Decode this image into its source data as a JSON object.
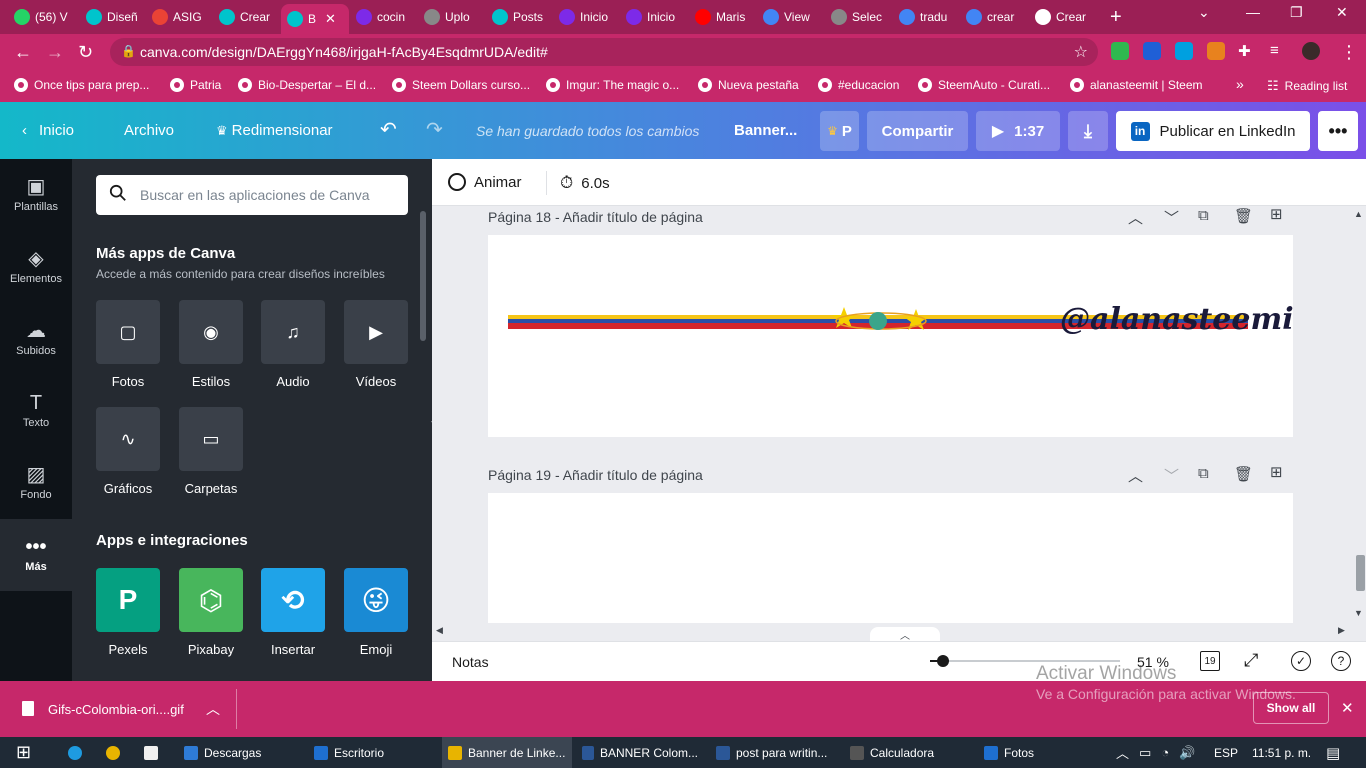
{
  "browser": {
    "tabs": [
      {
        "label": "(56) V",
        "icon": "whatsapp-icon",
        "color": "#25d366"
      },
      {
        "label": "Diseñ",
        "icon": "canva-icon",
        "color": "#00c4cc"
      },
      {
        "label": "ASIG",
        "icon": "gmail-icon",
        "color": "#ea4335"
      },
      {
        "label": "Crear",
        "icon": "canva-icon",
        "color": "#00c4cc"
      },
      {
        "label": "B",
        "icon": "canva-icon",
        "color": "#00c4cc"
      },
      {
        "label": "cocin",
        "icon": "canva-icon",
        "color": "#7d2ae8"
      },
      {
        "label": "Uplo",
        "icon": "upload-icon",
        "color": "#888888"
      },
      {
        "label": "Posts",
        "icon": "canva-icon",
        "color": "#00c4cc"
      },
      {
        "label": "Inicio",
        "icon": "canva-icon",
        "color": "#7d2ae8"
      },
      {
        "label": "Inicio",
        "icon": "canva-icon",
        "color": "#7d2ae8"
      },
      {
        "label": "Maris",
        "icon": "youtube-icon",
        "color": "#ff0000"
      },
      {
        "label": "View",
        "icon": "chrome-icon",
        "color": "#4285f4"
      },
      {
        "label": "Selec",
        "icon": "image-icon",
        "color": "#888888"
      },
      {
        "label": "tradu",
        "icon": "google-icon",
        "color": "#4285f4"
      },
      {
        "label": "crear",
        "icon": "google-icon",
        "color": "#4285f4"
      },
      {
        "label": "Crear",
        "icon": "dot-icon",
        "color": "#ffffff"
      }
    ],
    "url": "canva.com/design/DAErggYn468/irjgaH-fAcBy4EsqdmrUDA/edit#",
    "bookmarks": [
      "Once tips para prep...",
      "Patria",
      "Bio-Despertar – El d...",
      "Steem Dollars curso...",
      "Imgur: The magic o...",
      "Nueva pestaña",
      "#educacion",
      "SteemAuto - Curati...",
      "alanasteemit | Steem"
    ],
    "more_bookmarks": "»",
    "reading_list": "Reading list"
  },
  "header": {
    "home": "Inicio",
    "file": "Archivo",
    "resize": "Redimensionar",
    "saved": "Se han guardado todos los cambios",
    "design_name": "Banner...",
    "pro_label": "P",
    "share": "Compartir",
    "play_time": "1:37",
    "publish": "Publicar en LinkedIn",
    "accent": "#7d2ae8"
  },
  "rail": [
    {
      "label": "Plantillas",
      "icon": "templates-icon"
    },
    {
      "label": "Elementos",
      "icon": "elements-icon"
    },
    {
      "label": "Subidos",
      "icon": "uploads-icon"
    },
    {
      "label": "Texto",
      "icon": "text-icon"
    },
    {
      "label": "Fondo",
      "icon": "background-icon"
    },
    {
      "label": "Más",
      "icon": "more-icon"
    }
  ],
  "panel": {
    "search_placeholder": "Buscar en las aplicaciones de Canva",
    "section1_title": "Más apps de Canva",
    "section1_sub": "Accede a más contenido para crear diseños increíbles",
    "apps1": [
      "Fotos",
      "Estilos",
      "Audio",
      "Vídeos",
      "Gráficos",
      "Carpetas"
    ],
    "section2_title": "Apps e integraciones",
    "apps2": [
      {
        "label": "Pexels",
        "color": "#05a081"
      },
      {
        "label": "Pixabay",
        "color": "#48b65c"
      },
      {
        "label": "Insertar",
        "color": "#1fa3e8"
      },
      {
        "label": "Emoji",
        "color": "#1a8ad4"
      }
    ]
  },
  "editor": {
    "animate": "Animar",
    "duration": "6.0s",
    "page18": "Página 18 - Añadir título de página",
    "page19": "Página 19 - Añadir título de página",
    "banner_text": "@alanasteemit",
    "flag_colors": [
      "#f5c518",
      "#2a4fa8",
      "#d4252c"
    ]
  },
  "bottom": {
    "notes": "Notas",
    "zoom": "51 %",
    "zoom_level": 0.51,
    "pages": "19"
  },
  "download": {
    "file": "Gifs-cColombia-ori....gif",
    "show_all": "Show all",
    "watermark_title": "Activar Windows",
    "watermark_sub": "Ve a Configuración para activar Windows."
  },
  "taskbar": {
    "items": [
      "Descargas",
      "Escritorio",
      "Banner de Linke...",
      "BANNER Colom...",
      "post para writin...",
      "Calculadora",
      "Fotos"
    ],
    "lang": "ESP",
    "time": "11:51 p. m."
  }
}
